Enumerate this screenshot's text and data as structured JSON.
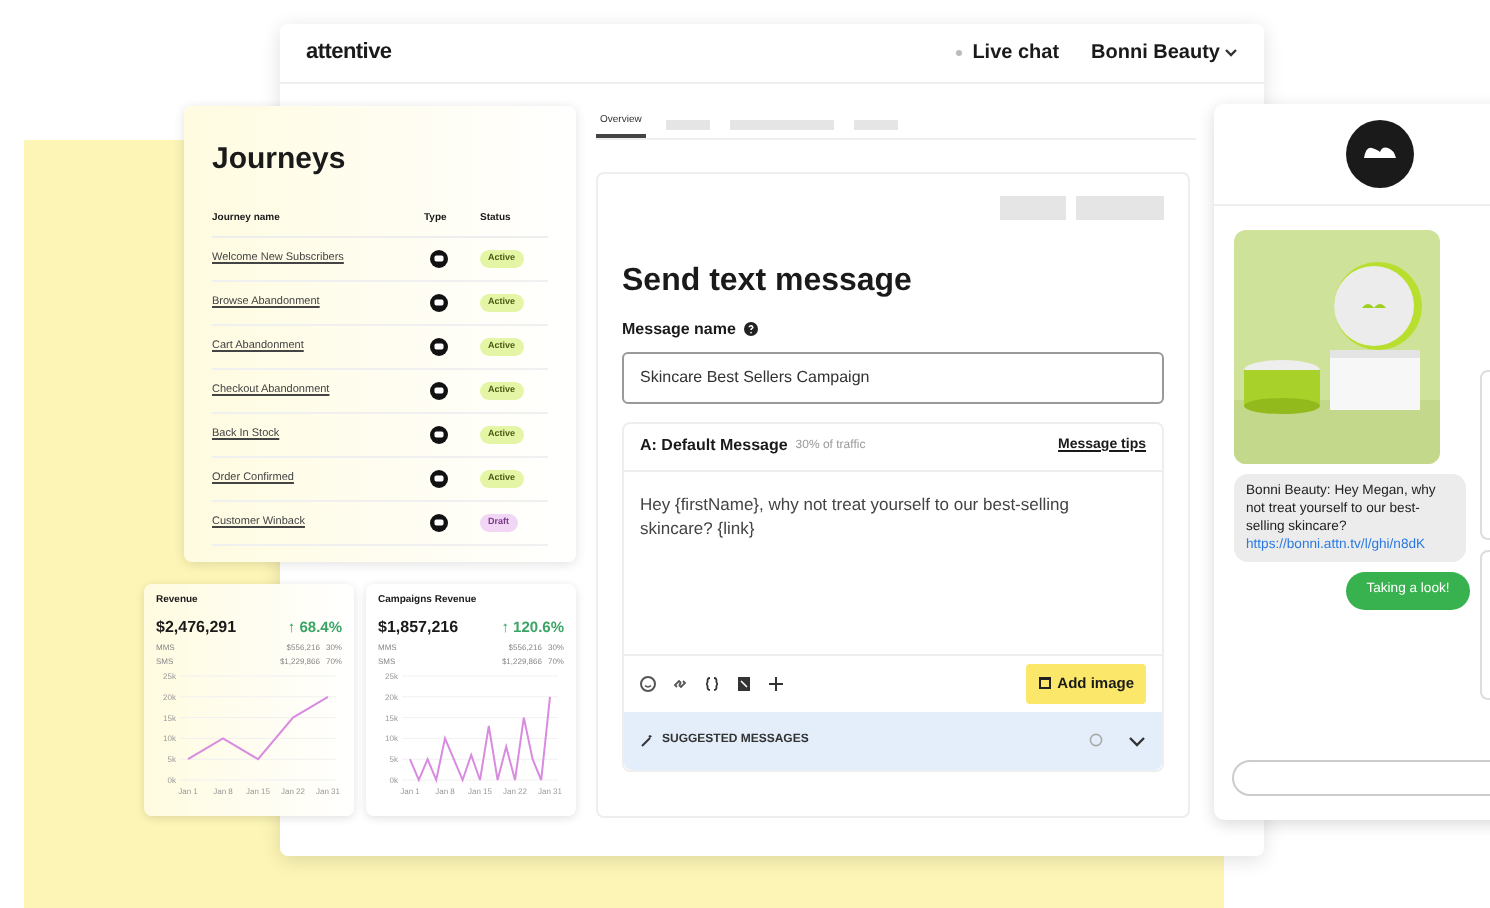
{
  "header": {
    "logo": "attentive",
    "live_chat": "Live chat",
    "account": "Bonni Beauty"
  },
  "journeys": {
    "title": "Journeys",
    "columns": [
      "Journey name",
      "Type",
      "Status"
    ],
    "rows": [
      {
        "name": "Welcome New Subscribers",
        "status": "Active",
        "kind": "active"
      },
      {
        "name": "Browse Abandonment",
        "status": "Active",
        "kind": "active"
      },
      {
        "name": "Cart Abandonment",
        "status": "Active",
        "kind": "active"
      },
      {
        "name": "Checkout Abandonment",
        "status": "Active",
        "kind": "active"
      },
      {
        "name": "Back In Stock",
        "status": "Active",
        "kind": "active"
      },
      {
        "name": "Order Confirmed",
        "status": "Active",
        "kind": "active"
      },
      {
        "name": "Customer Winback",
        "status": "Draft",
        "kind": "draft"
      }
    ]
  },
  "metrics": [
    {
      "title": "Revenue",
      "total": "$2,476,291",
      "change": "↑ 68.4%",
      "breakdown": [
        {
          "label": "MMS",
          "value": "$556,216",
          "share": "30%"
        },
        {
          "label": "SMS",
          "value": "$1,229,866",
          "share": "70%"
        }
      ],
      "chart_data": {
        "type": "line",
        "categories": [
          "Jan 1",
          "Jan 8",
          "Jan 15",
          "Jan 22",
          "Jan 31"
        ],
        "series": [
          {
            "color": "#d98be0",
            "values": [
              5,
              10,
              5,
              15,
              20
            ]
          }
        ],
        "grid": true,
        "ylim": [
          0,
          25
        ],
        "yticks": [
          {
            "value": 0,
            "label": "0k"
          },
          {
            "value": 5,
            "label": "5k"
          },
          {
            "value": 10,
            "label": "10k"
          },
          {
            "value": 15,
            "label": "15k"
          },
          {
            "value": 20,
            "label": "20k"
          },
          {
            "value": 25,
            "label": "25k"
          }
        ]
      }
    },
    {
      "title": "Campaigns Revenue",
      "total": "$1,857,216",
      "change": "↑ 120.6%",
      "breakdown": [
        {
          "label": "MMS",
          "value": "$556,216",
          "share": "30%"
        },
        {
          "label": "SMS",
          "value": "$1,229,866",
          "share": "70%"
        }
      ],
      "chart_data": {
        "type": "line",
        "categories": [
          "Jan 1",
          null,
          null,
          null,
          "Jan 8",
          null,
          null,
          null,
          "Jan 15",
          null,
          null,
          null,
          "Jan 22",
          null,
          null,
          null,
          "Jan 31"
        ],
        "series": [
          {
            "color": "#d98be0",
            "values": [
              5,
              0,
              5,
              0,
              10,
              5,
              0,
              6,
              0,
              13,
              0,
              8,
              0,
              15,
              5,
              0,
              20
            ]
          }
        ],
        "grid": true,
        "ylim": [
          0,
          25
        ],
        "yticks": [
          {
            "value": 0,
            "label": "0k"
          },
          {
            "value": 5,
            "label": "5k"
          },
          {
            "value": 10,
            "label": "10k"
          },
          {
            "value": 15,
            "label": "15k"
          },
          {
            "value": 20,
            "label": "20k"
          },
          {
            "value": 25,
            "label": "25k"
          }
        ]
      }
    }
  ],
  "tabs": [
    {
      "label": "Overview",
      "selected": true
    }
  ],
  "composer": {
    "title": "Send text message",
    "name_label": "Message name",
    "name_value": "Skincare Best Sellers Campaign",
    "variant": "A: Default Message",
    "traffic": "30% of traffic",
    "tips": "Message tips",
    "body": "Hey {firstName}, why not treat yourself to our best-selling skincare? {link}",
    "add_image": "Add image",
    "suggested": "SUGGESTED MESSAGES"
  },
  "phone": {
    "incoming": "Bonni Beauty: Hey Megan, why not treat yourself to our best-selling skincare?",
    "link": "https://bonni.attn.tv/l/ghi/n8dK",
    "reply": "Taking a look!"
  }
}
